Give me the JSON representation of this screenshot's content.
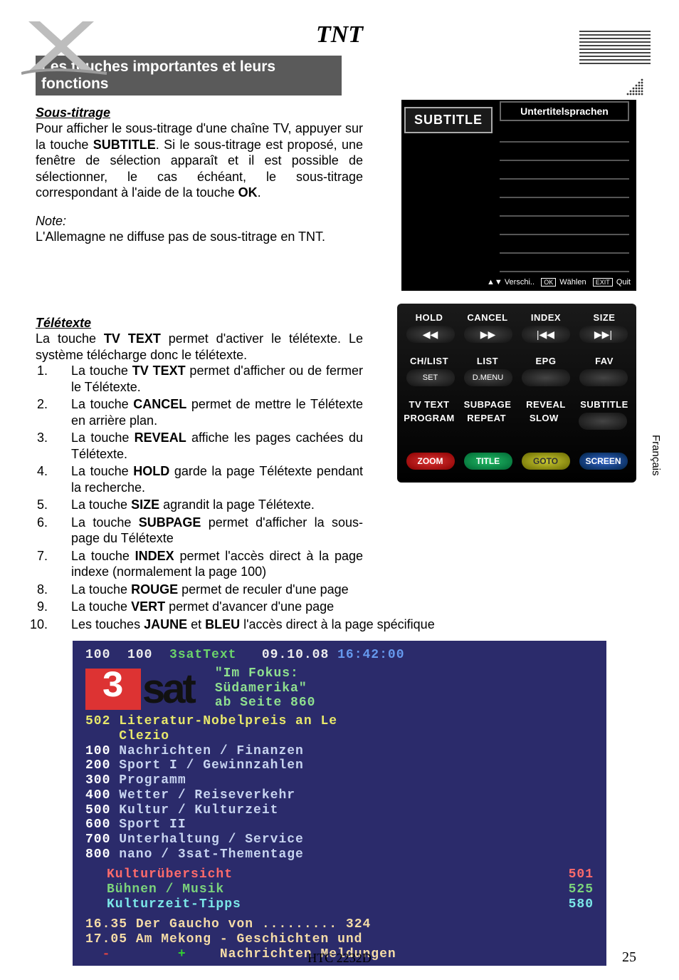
{
  "page": {
    "title": "TNT",
    "footer_model": "HTC 2232D",
    "page_number": "25",
    "side_language": "Français"
  },
  "section_bar": "Les touches importantes et leurs fonctions",
  "subtitle_section": {
    "heading": "Sous-titrage",
    "para_pre": "Pour afficher le sous-titrage d'une chaîne TV, appuyer sur la touche ",
    "key1": "SUBTITLE",
    "para_mid": ". Si le sous-titrage est proposé, une fenêtre de sélection apparaît et il est possible de sélectionner, le cas échéant, le sous-titrage correspondant à l'aide de la touche ",
    "key2": "OK",
    "para_end": ".",
    "note_label": "Note:",
    "note_text": "L'Allemagne ne diffuse pas de sous-titrage en TNT."
  },
  "osd": {
    "tab_label": "SUBTITLE",
    "lang_title": "Untertitelsprachen",
    "foot_scroll": "Verschi..",
    "foot_ok_tag": "OK",
    "foot_ok": "Wählen",
    "foot_exit_tag": "EXIT",
    "foot_exit": "Quit"
  },
  "teletext_section": {
    "heading": "Télétexte",
    "intro_pre": "La touche ",
    "intro_key": "TV TEXT",
    "intro_post": " permet d'activer le télétexte. Le système télécharge donc le télétexte.",
    "items": [
      {
        "pre": "La touche ",
        "bold": "TV TEXT",
        "post": " permet d'afficher ou de fermer le Télétexte."
      },
      {
        "pre": "La touche ",
        "bold": "CANCEL",
        "post": " permet de mettre le Télétexte en arrière plan."
      },
      {
        "pre": "La touche ",
        "bold": "REVEAL",
        "post": " affiche les pages cachées du Télétexte."
      },
      {
        "pre": "La touche ",
        "bold": "HOLD",
        "post": " garde la page Télétexte pendant la recherche."
      },
      {
        "pre": "La touche ",
        "bold": "SIZE",
        "post": " agrandit la page Télétexte."
      },
      {
        "pre": "La touche ",
        "bold": "SUBPAGE",
        "post": " permet d'afficher la sous-page du Télétexte"
      },
      {
        "pre": "La touche ",
        "bold": "INDEX",
        "post": " permet l'accès direct à la page indexe (normalement la page 100)"
      },
      {
        "pre": "La touche ",
        "bold": "ROUGE",
        "post": " permet de reculer d'une page"
      },
      {
        "pre": "La touche ",
        "bold": "VERT",
        "post": " permet d'avancer d'une page"
      },
      {
        "pre": "Les touches ",
        "bold": "JAUNE",
        "post_mid": " et ",
        "bold2": "BLEU",
        "post": " l'accès direct à la page spécifique"
      }
    ]
  },
  "remote": {
    "row1": [
      "HOLD",
      "CANCEL",
      "INDEX",
      "SIZE"
    ],
    "icons": [
      "◀◀",
      "▶▶",
      "|◀◀",
      "▶▶|"
    ],
    "row2": [
      "CH/LIST",
      "LIST",
      "EPG",
      "FAV"
    ],
    "row2b": [
      "SET",
      "D.MENU",
      "",
      ""
    ],
    "row3": [
      "TV TEXT",
      "SUBPAGE",
      "REVEAL",
      "SUBTITLE"
    ],
    "row3b": [
      "PROGRAM",
      "REPEAT",
      "SLOW",
      ""
    ],
    "color": [
      "ZOOM",
      "TITLE",
      "GOTO",
      "SCREEN"
    ]
  },
  "ttx": {
    "hdr_a": "100",
    "hdr_b": "100",
    "hdr_name": "3satText",
    "hdr_date": "09.10.08",
    "hdr_time": "16:42:00",
    "logo_3": "3",
    "logo_sat": "sat",
    "fokus1": "\"Im Fokus:",
    "fokus2": "Südamerika\"",
    "fokus3": "ab Seite 860",
    "hl_num": "502",
    "hl_text1": "Literatur-Nobelpreis an Le",
    "hl_text2": "Clezio",
    "menu": [
      {
        "num": "100",
        "text": "Nachrichten / Finanzen"
      },
      {
        "num": "200",
        "text": "Sport I / Gewinnzahlen"
      },
      {
        "num": "300",
        "text": "Programm"
      },
      {
        "num": "400",
        "text": "Wetter / Reiseverkehr"
      },
      {
        "num": "500",
        "text": "Kultur / Kulturzeit"
      },
      {
        "num": "600",
        "text": "Sport II"
      },
      {
        "num": "700",
        "text": "Unterhaltung / Service"
      },
      {
        "num": "800",
        "text": "nano / 3sat-Thementage"
      }
    ],
    "color_lines": [
      {
        "cls": "red",
        "text": "Kulturübersicht",
        "num": "501"
      },
      {
        "cls": "green",
        "text": "Bühnen / Musik",
        "num": "525"
      },
      {
        "cls": "cyan",
        "text": "Kulturzeit-Tipps",
        "num": "580"
      }
    ],
    "prog1_time": "16.35",
    "prog1_text": "Der Gaucho von .........",
    "prog1_num": "324",
    "prog2_time": "17.05",
    "prog2_text": "Am Mekong - Geschichten und",
    "foot_minus": "-",
    "foot_plus": "+",
    "foot_msg": "Nachrichten Meldungen"
  }
}
